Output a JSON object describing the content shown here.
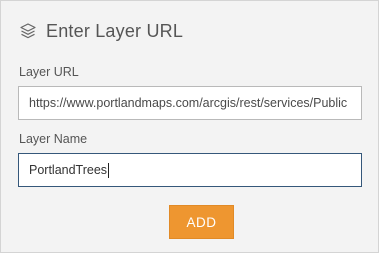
{
  "dialog": {
    "title": "Enter Layer URL",
    "title_icon": "layers-icon"
  },
  "layer_url": {
    "label": "Layer URL",
    "value": "https://www.portlandmaps.com/arcgis/rest/services/Public"
  },
  "layer_name": {
    "label": "Layer Name",
    "value": "PortlandTrees"
  },
  "actions": {
    "add_label": "ADD"
  },
  "colors": {
    "panel_background": "#f3f3f3",
    "accent_button": "#ee9630",
    "focused_field_border": "#35577a",
    "text": "#555555"
  }
}
